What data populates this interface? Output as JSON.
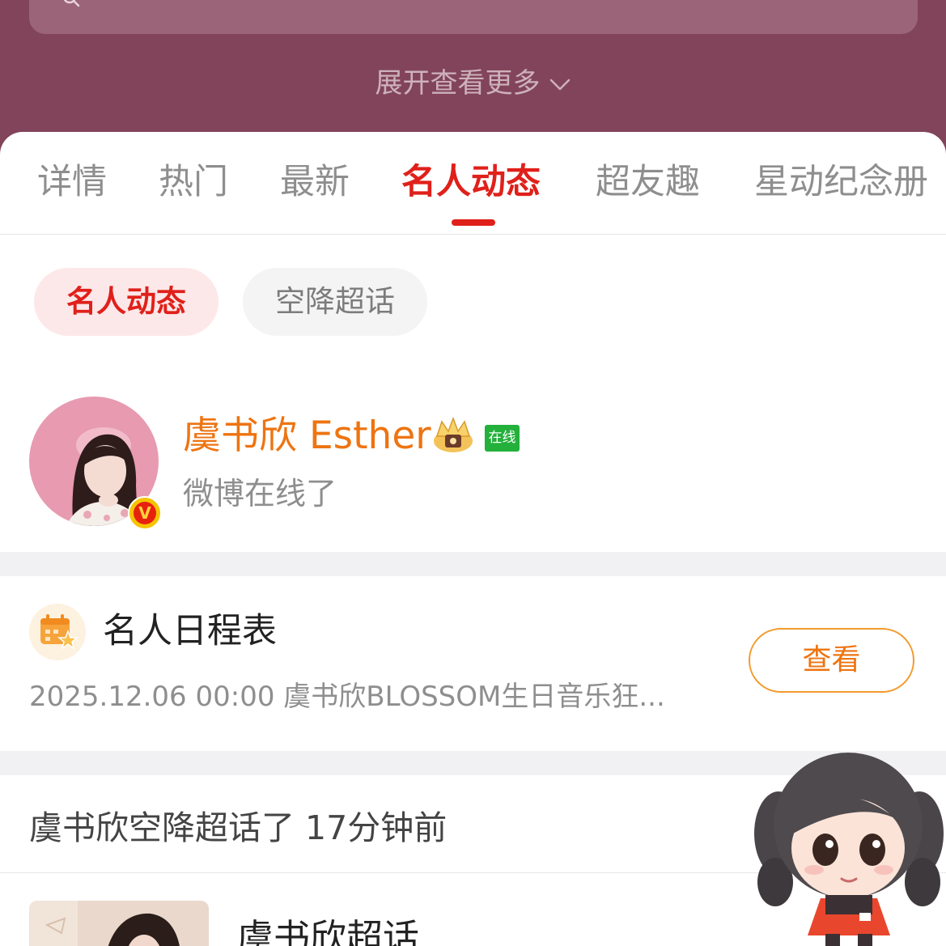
{
  "header": {
    "expand_label": "展开查看更多"
  },
  "tabs": [
    {
      "label": "详情"
    },
    {
      "label": "热门"
    },
    {
      "label": "最新"
    },
    {
      "label": "名人动态",
      "active": true
    },
    {
      "label": "超友趣"
    },
    {
      "label": "星动纪念册"
    }
  ],
  "chips": {
    "active": "名人动态",
    "inactive": "空降超话"
  },
  "celebrity": {
    "name": "虞书欣 Esther",
    "online_badge": "在线",
    "status": "微博在线了",
    "verified_badge": "V"
  },
  "schedule": {
    "title": "名人日程表",
    "detail": "2025.12.06 00:00 虞书欣BLOSSOM生日音乐狂...",
    "button_label": "查看"
  },
  "feed": {
    "header": "虞书欣空降超话了 17分钟前",
    "post_title": "虞书欣超话"
  },
  "colors": {
    "header_bg": "#82445a",
    "accent_red": "#e0201a",
    "accent_orange": "#ee7411",
    "online_green": "#23b03b"
  },
  "icons": {
    "search": "search-icon",
    "chevron": "chevron-down-icon",
    "crown": "crown-icon",
    "schedule": "calendar-star-icon"
  }
}
